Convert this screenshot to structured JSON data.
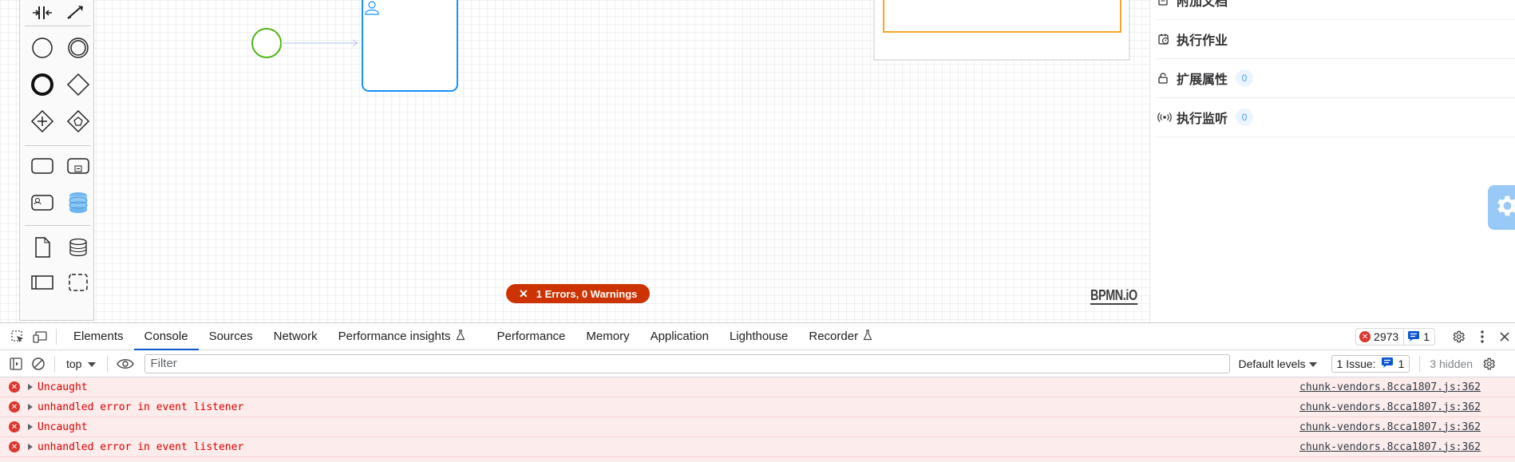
{
  "canvas": {
    "watermark": "BPMN.iO",
    "error_badge": {
      "icon": "close-icon",
      "text": "1 Errors, 0 Warnings"
    }
  },
  "panel": {
    "rows": [
      {
        "label": "附加文档",
        "icon": "document-icon",
        "count": null
      },
      {
        "label": "执行作业",
        "icon": "clock-calendar-icon",
        "count": null
      },
      {
        "label": "扩展属性",
        "icon": "lock-icon",
        "count": "0"
      },
      {
        "label": "执行监听",
        "icon": "broadcast-icon",
        "count": "0"
      }
    ],
    "fab_icon": "gear-icon"
  },
  "devtools": {
    "tabs": [
      {
        "label": "Elements",
        "active": false,
        "flask": false
      },
      {
        "label": "Console",
        "active": true,
        "flask": false
      },
      {
        "label": "Sources",
        "active": false,
        "flask": false
      },
      {
        "label": "Network",
        "active": false,
        "flask": false
      },
      {
        "label": "Performance insights",
        "active": false,
        "flask": true
      },
      {
        "label": "Performance",
        "active": false,
        "flask": false
      },
      {
        "label": "Memory",
        "active": false,
        "flask": false
      },
      {
        "label": "Application",
        "active": false,
        "flask": false
      },
      {
        "label": "Lighthouse",
        "active": false,
        "flask": false
      },
      {
        "label": "Recorder",
        "active": false,
        "flask": true
      }
    ],
    "error_count": "2973",
    "message_count": "1",
    "toolbar": {
      "context": "top",
      "filter_placeholder": "Filter",
      "levels": "Default levels",
      "issues_label": "1 Issue:",
      "issues_count": "1",
      "hidden": "3 hidden"
    },
    "logs": [
      {
        "message": "Uncaught",
        "source": "chunk-vendors.8cca1807.js:362"
      },
      {
        "message": "unhandled error in event listener",
        "source": "chunk-vendors.8cca1807.js:362"
      },
      {
        "message": "Uncaught",
        "source": "chunk-vendors.8cca1807.js:362"
      },
      {
        "message": "unhandled error in event listener",
        "source": "chunk-vendors.8cca1807.js:362"
      }
    ]
  },
  "colors": {
    "start_event": "#52b415",
    "user_task": "#1890ff",
    "highlight_box": "#f5a623",
    "error_badge": "#cc3300",
    "console_error": "#dc0000",
    "active_tab": "#0b57d0"
  }
}
